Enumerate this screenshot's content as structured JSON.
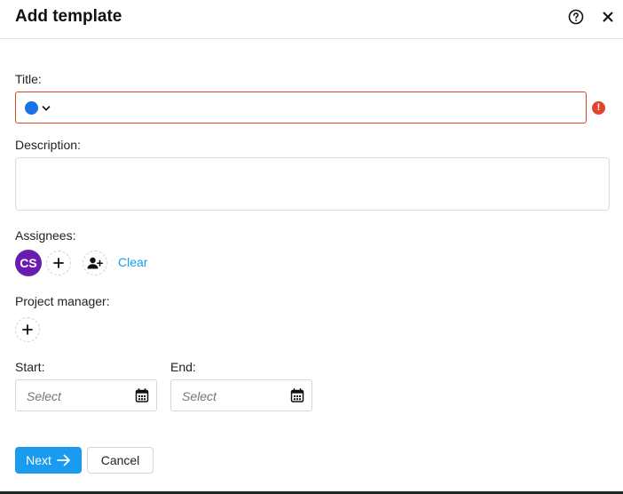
{
  "dialog": {
    "title": "Add template"
  },
  "fields": {
    "title_label": "Title:",
    "title_value": "",
    "title_color": "#1a73e8",
    "description_label": "Description:",
    "description_value": "",
    "assignees_label": "Assignees:",
    "assignee_initials": "CS",
    "clear_label": "Clear",
    "project_manager_label": "Project manager:",
    "start_label": "Start:",
    "start_placeholder": "Select",
    "end_label": "End:",
    "end_placeholder": "Select"
  },
  "buttons": {
    "next_label": "Next",
    "cancel_label": "Cancel"
  },
  "icons": {
    "help": "help-circle-icon",
    "close": "close-icon",
    "error": "error-icon",
    "add_user": "add-user-icon",
    "plus": "plus-icon",
    "calendar": "calendar-icon",
    "arrow": "arrow-right-icon"
  },
  "colors": {
    "accent": "#1a9bef",
    "link": "#1a9bef",
    "error": "#e0442e",
    "avatar": "#6a1bb0",
    "error_border": "#d9472b"
  }
}
